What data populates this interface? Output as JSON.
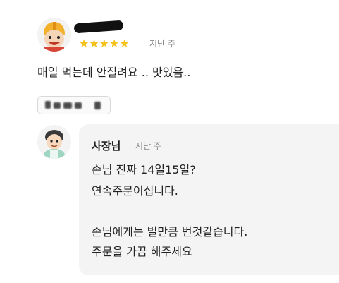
{
  "review": {
    "rating_stars": "★★★★★",
    "rating": 5,
    "time_ago": "지난 주",
    "text": "매일 먹는데 안질려요 .. 맛있음..",
    "avatar_icon": "user-character-avatar-icon",
    "menu_tags_icon": "blurred-menu-tags"
  },
  "reply": {
    "owner_label": "사장님",
    "time_ago": "지난 주",
    "avatar_icon": "owner-character-avatar-icon",
    "lines": [
      "손님 진짜 14일15일?",
      "연속주문이십니다.",
      "",
      "손님에게는 벌만큼 번것같습니다.",
      "주문을 가끔 해주세요"
    ]
  },
  "colors": {
    "star": "#f4c21b",
    "bubble": "#f4f4f4",
    "muted_text": "#888888",
    "text": "#222222"
  }
}
